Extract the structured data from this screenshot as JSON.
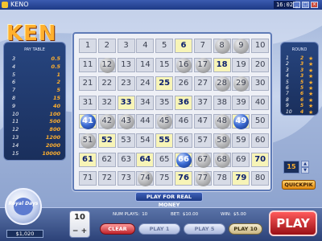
{
  "window": {
    "title": "KENO",
    "clock": "16:02",
    "minimize": "_",
    "maximize": "□",
    "close": "×"
  },
  "logo": {
    "text": "KEN"
  },
  "pay_table": {
    "title": "PAY TABLE",
    "rows": [
      {
        "hits": "3",
        "pay": "0.5"
      },
      {
        "hits": "4",
        "pay": "0.5"
      },
      {
        "hits": "5",
        "pay": "1"
      },
      {
        "hits": "6",
        "pay": "2"
      },
      {
        "hits": "7",
        "pay": "5"
      },
      {
        "hits": "8",
        "pay": "15"
      },
      {
        "hits": "9",
        "pay": "40"
      },
      {
        "hits": "10",
        "pay": "100"
      },
      {
        "hits": "11",
        "pay": "500"
      },
      {
        "hits": "12",
        "pay": "800"
      },
      {
        "hits": "13",
        "pay": "1200"
      },
      {
        "hits": "14",
        "pay": "2000"
      },
      {
        "hits": "15",
        "pay": "10000"
      }
    ]
  },
  "round": {
    "title": "ROUND",
    "rows": [
      {
        "n": "1",
        "v": "2"
      },
      {
        "n": "2",
        "v": "3"
      },
      {
        "n": "3",
        "v": "3"
      },
      {
        "n": "4",
        "v": "3"
      },
      {
        "n": "5",
        "v": "5"
      },
      {
        "n": "6",
        "v": "5"
      },
      {
        "n": "7",
        "v": "6"
      },
      {
        "n": "8",
        "v": "6"
      },
      {
        "n": "9",
        "v": "5"
      },
      {
        "n": "10",
        "v": "4"
      }
    ]
  },
  "board": {
    "numbers": [
      1,
      2,
      3,
      4,
      5,
      6,
      7,
      8,
      9,
      10,
      11,
      12,
      13,
      14,
      15,
      16,
      17,
      18,
      19,
      20,
      21,
      22,
      23,
      24,
      25,
      26,
      27,
      28,
      29,
      30,
      31,
      32,
      33,
      34,
      35,
      36,
      37,
      38,
      39,
      40,
      41,
      42,
      43,
      44,
      45,
      46,
      47,
      48,
      49,
      50,
      51,
      52,
      53,
      54,
      55,
      56,
      57,
      58,
      59,
      60,
      61,
      62,
      63,
      64,
      65,
      66,
      67,
      68,
      69,
      70,
      71,
      72,
      73,
      74,
      75,
      76,
      77,
      78,
      79,
      80
    ],
    "selected": [
      6,
      18,
      25,
      33,
      36,
      49,
      52,
      55,
      61,
      64,
      66,
      70,
      76,
      79,
      41
    ],
    "drawn": [
      8,
      9,
      12,
      16,
      17,
      28,
      29,
      41,
      42,
      43,
      45,
      48,
      49,
      51,
      58,
      66,
      67,
      68,
      74,
      77
    ],
    "hits": [
      41,
      49,
      66
    ]
  },
  "banner": "PLAY FOR REAL MONEY",
  "bet_box": {
    "value": "15",
    "up": "▲",
    "down": "▼"
  },
  "quickpick": "QUICKPIK",
  "emblem": {
    "text": "Royal Days"
  },
  "balance": "$1,020",
  "chip": {
    "value": "10",
    "minus": "−",
    "plus": "+"
  },
  "stats": {
    "num_plays_label": "NUM PLAYS:",
    "num_plays": "10",
    "bet_label": "BET:",
    "bet": "$10.00",
    "win_label": "WIN:",
    "win": "$5.00"
  },
  "buttons": {
    "clear": "CLEAR",
    "play1": "PLAY 1",
    "play5": "PLAY 5",
    "play10": "PLAY 10",
    "play": "PLAY"
  }
}
